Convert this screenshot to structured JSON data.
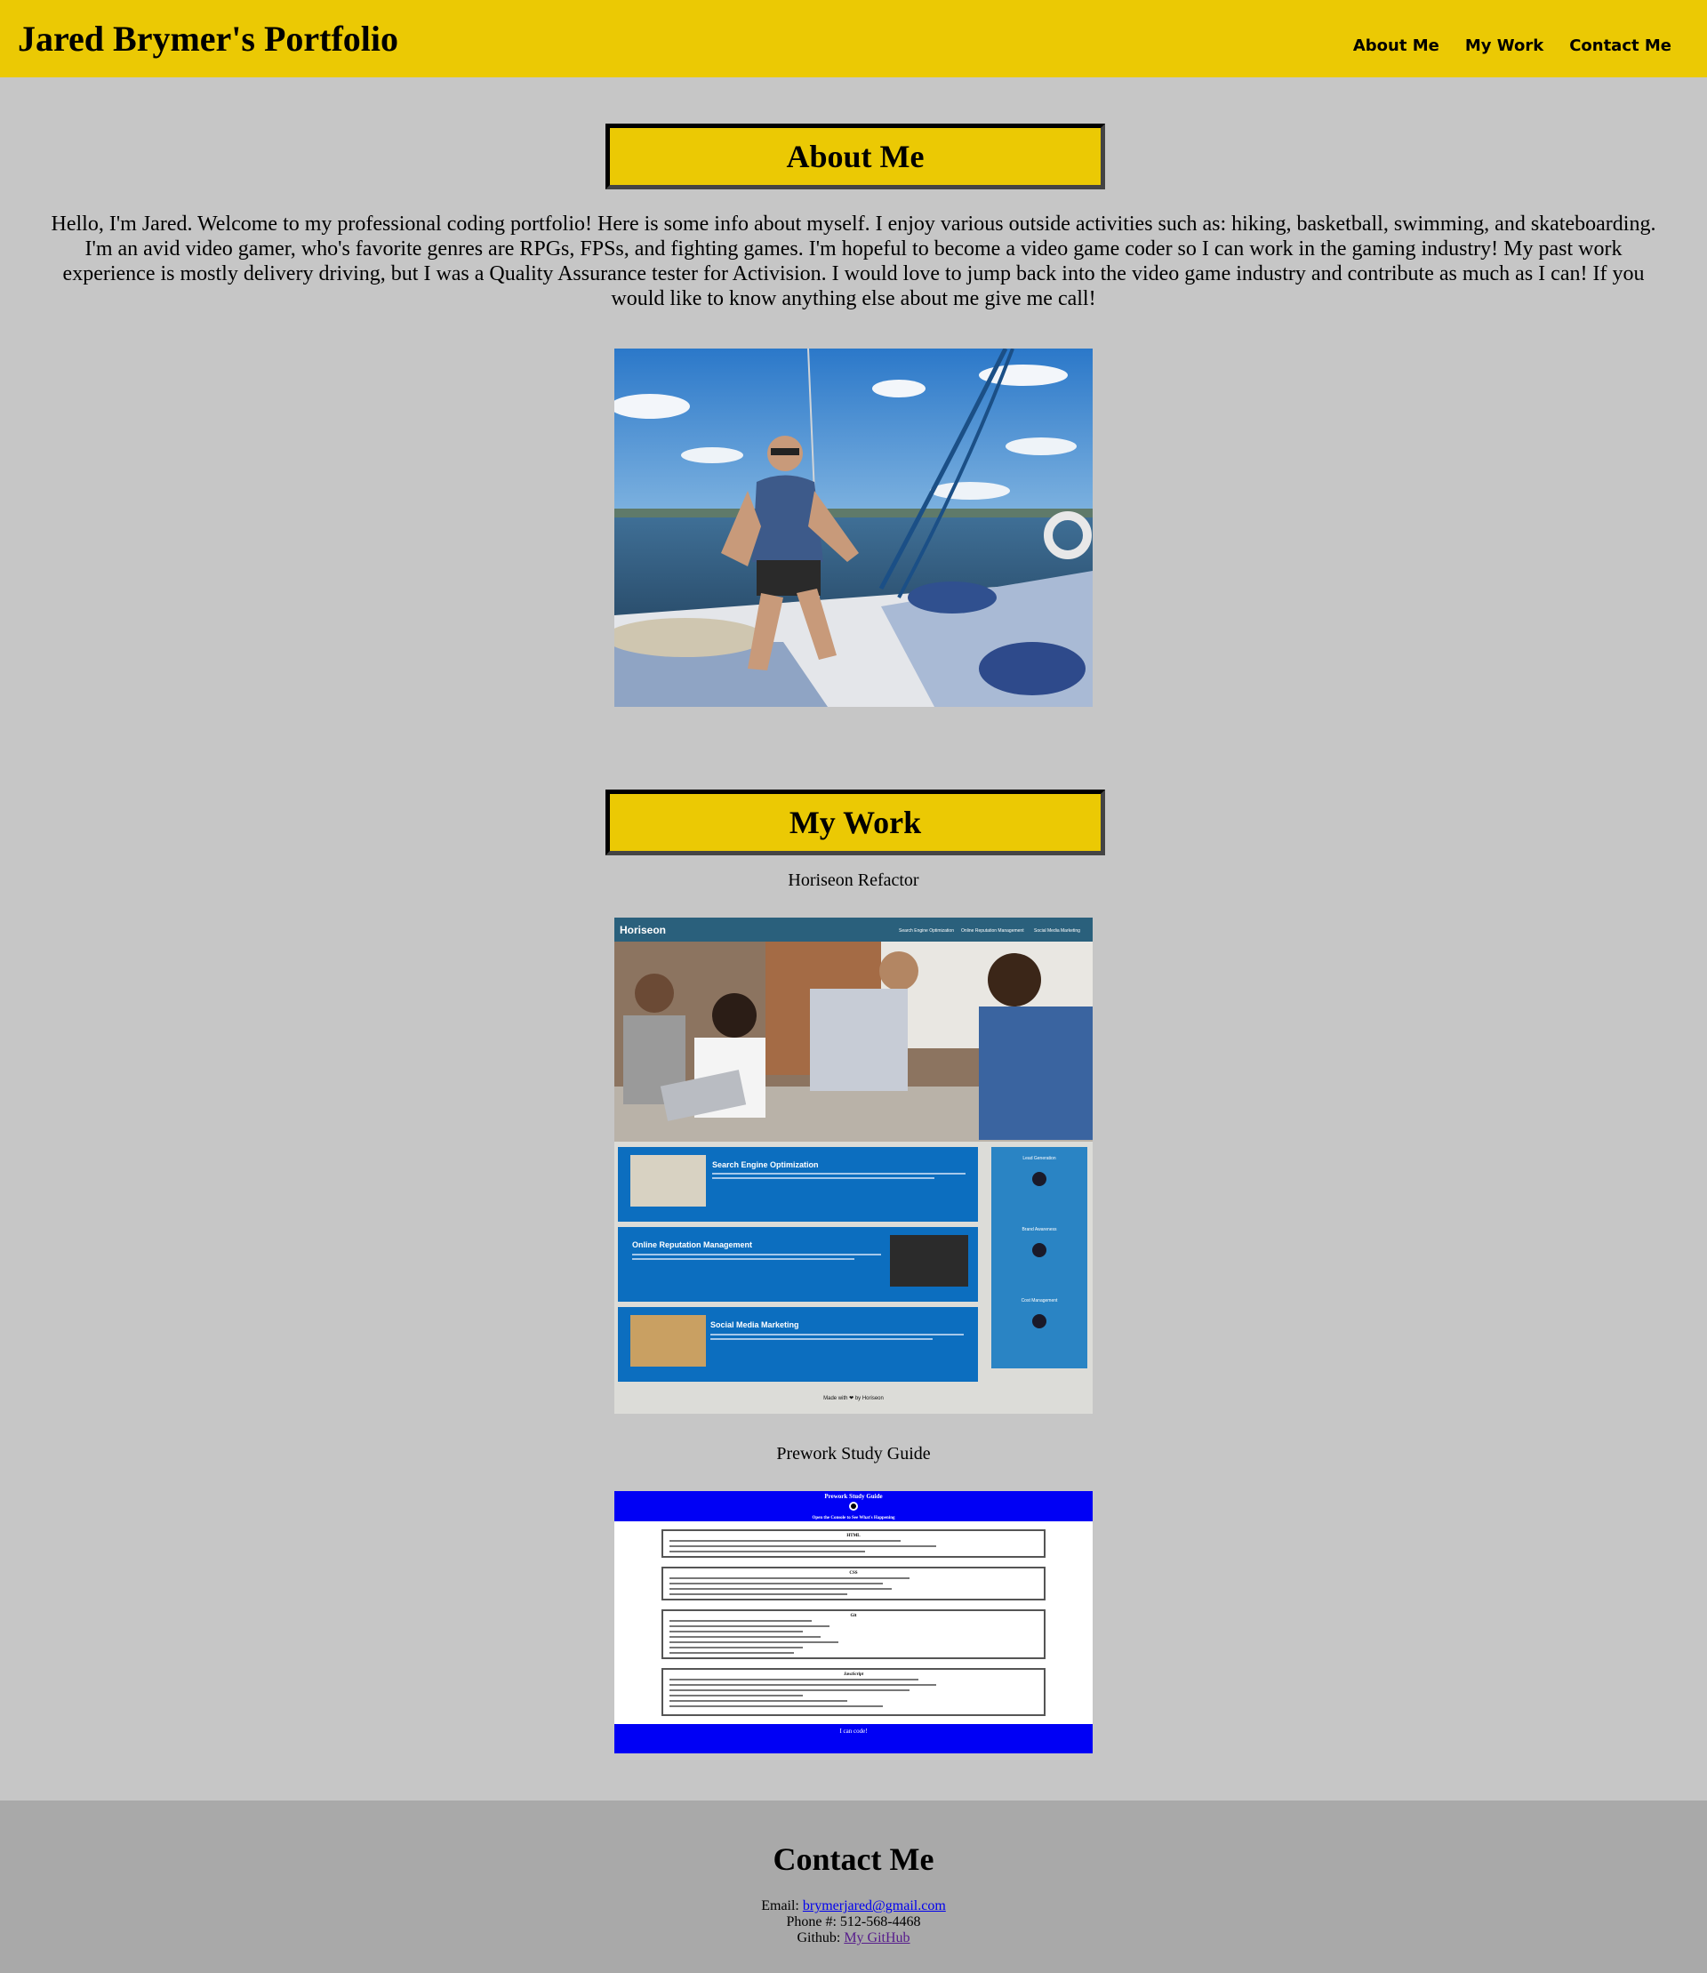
{
  "header": {
    "title": "Jared Brymer's Portfolio",
    "nav": [
      "About Me",
      "My Work",
      "Contact Me"
    ],
    "color": "#ebc904"
  },
  "about": {
    "heading": "About Me",
    "text": "Hello, I'm Jared. Welcome to my professional coding portfolio! Here is some info about myself. I enjoy various outside activities such as: hiking, basketball, swimming, and skateboarding. I'm an avid video gamer, who's favorite genres are RPGs, FPSs, and fighting games. I'm hopeful to become a video game coder so I can work in the gaming industry! My past work experience is mostly delivery driving, but I was a Quality Assurance tester for Activision. I would love to jump back into the video game industry and contribute as much as I can! If you would like to know anything else about me give me call!"
  },
  "work": {
    "heading": "My Work",
    "projects": [
      {
        "title": "Horiseon Refactor",
        "preview": {
          "brand": "Horiseon",
          "nav": [
            "Search Engine Optimization",
            "Online Reputation Management",
            "Social Media Marketing"
          ],
          "cards": [
            "Search Engine Optimization",
            "Online Reputation Management",
            "Social Media Marketing"
          ],
          "benefits": [
            "Lead Generation",
            "Brand Awareness",
            "Cost Management"
          ],
          "footer": "Made with ❤ by Horiseon"
        }
      },
      {
        "title": "Prework Study Guide",
        "preview": {
          "title": "Prework Study Guide",
          "subtitle": "Open the Console to See What's Happening",
          "topics": [
            "HTML",
            "CSS",
            "Git",
            "JavaScript"
          ],
          "footer": "I can code!"
        }
      }
    ]
  },
  "contact": {
    "heading": "Contact Me",
    "email_label": "Email:",
    "email": "brymerjared@gmail.com",
    "phone_label": "Phone #:",
    "phone": "512-568-4468",
    "github_label": "Github:",
    "github": "My GitHub"
  }
}
